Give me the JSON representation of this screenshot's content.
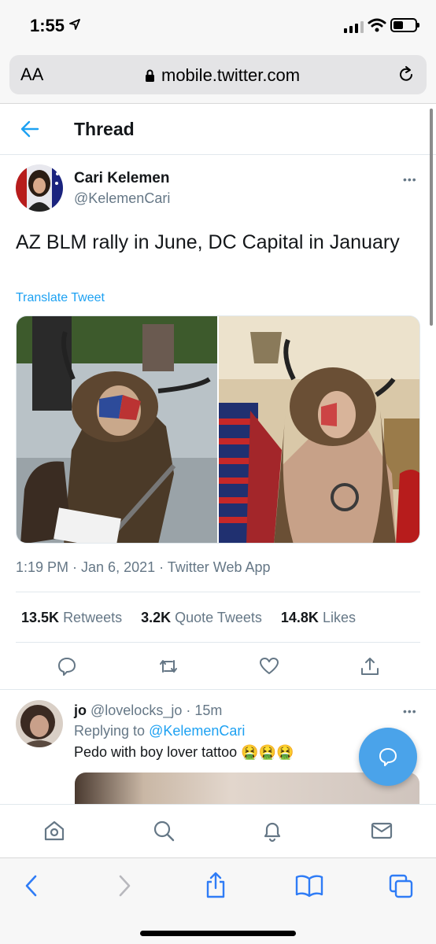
{
  "status_bar": {
    "time": "1:55"
  },
  "browser": {
    "aa_label": "AA",
    "url": "mobile.twitter.com"
  },
  "header": {
    "title": "Thread"
  },
  "tweet": {
    "author_name": "Cari Kelemen",
    "author_handle": "@KelemenCari",
    "text": "AZ BLM rally in June, DC Capital in January",
    "translate_label": "Translate Tweet",
    "meta": "1:19 PM · Jan 6, 2021 · Twitter Web App",
    "stats": {
      "retweets_count": "13.5K",
      "retweets_label": "Retweets",
      "quotes_count": "3.2K",
      "quotes_label": "Quote Tweets",
      "likes_count": "14.8K",
      "likes_label": "Likes"
    }
  },
  "reply": {
    "name": "jo",
    "handle_time": "@lovelocks_jo · 15m",
    "replying_prefix": "Replying to",
    "replying_to": "@KelemenCari",
    "text": "Pedo with boy lover tattoo 🤮🤮🤮"
  },
  "colors": {
    "accent": "#1da1f2",
    "fab": "#4aa3ea",
    "safari_blue": "#3b82f6"
  }
}
